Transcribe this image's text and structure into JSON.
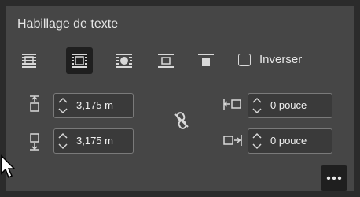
{
  "panel": {
    "title": "Habillage de texte",
    "invert_label": "Inverser",
    "top_offset": "3,175 m",
    "bottom_offset": "3,175 m",
    "left_offset": "0 pouce",
    "right_offset": "0 pouce",
    "selected_wrap": "wrap-around-bounding-box"
  },
  "colors": {
    "panel_bg": "#464646",
    "selected_bg": "#1f1f1f",
    "text": "#e6e6e6"
  },
  "icons": {
    "wrap_options": [
      "no-text-wrap-icon",
      "wrap-around-bounding-box-icon",
      "wrap-around-object-shape-icon",
      "jump-object-icon",
      "jump-to-next-column-icon"
    ],
    "more": "more-options-icon",
    "link": "unlink-offsets-icon"
  }
}
